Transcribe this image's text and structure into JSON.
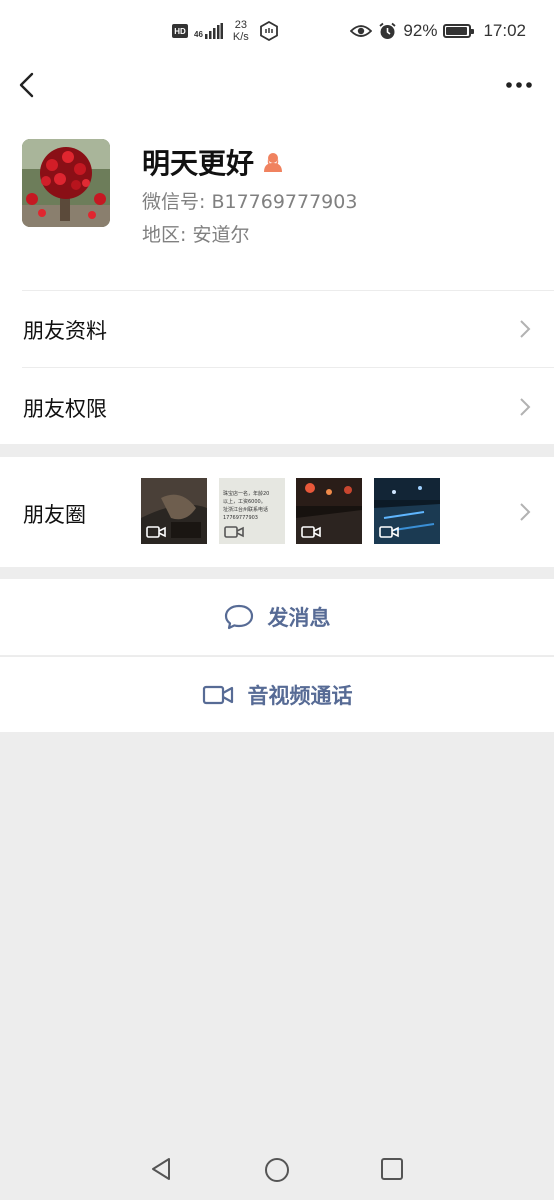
{
  "status_bar": {
    "hd": "HD",
    "network": "46",
    "speed_value": "23",
    "speed_unit": "K/s",
    "battery": "92%",
    "battery_level": 0.92,
    "time": "17:02",
    "icons": [
      "signal-icon",
      "hexagon-icon",
      "eye-icon",
      "alarm-icon",
      "battery-icon"
    ]
  },
  "nav": {
    "back_icon": "back-arrow-icon",
    "more_icon": "more-dots-icon"
  },
  "profile": {
    "nickname": "明天更好",
    "gender_icon": "female-user-icon",
    "wechat_id": "微信号: B17769777903",
    "region": "地区: 安道尔"
  },
  "rows": {
    "friend_info": "朋友资料",
    "friend_permissions": "朋友权限",
    "moments": "朋友圈"
  },
  "moments_thumbnails": [
    {
      "kind": "video"
    },
    {
      "kind": "video"
    },
    {
      "kind": "video"
    },
    {
      "kind": "video"
    }
  ],
  "thumbnail_text": [
    "珠宝店一名，年龄20",
    "以上，工资6000。",
    "址浙江台州联系电话",
    "17769777903"
  ],
  "actions": {
    "send_message": "发消息",
    "av_call": "音视频通话"
  },
  "colors": {
    "link": "#576b95",
    "background": "#ededed",
    "female_badge": "#f0825f"
  }
}
